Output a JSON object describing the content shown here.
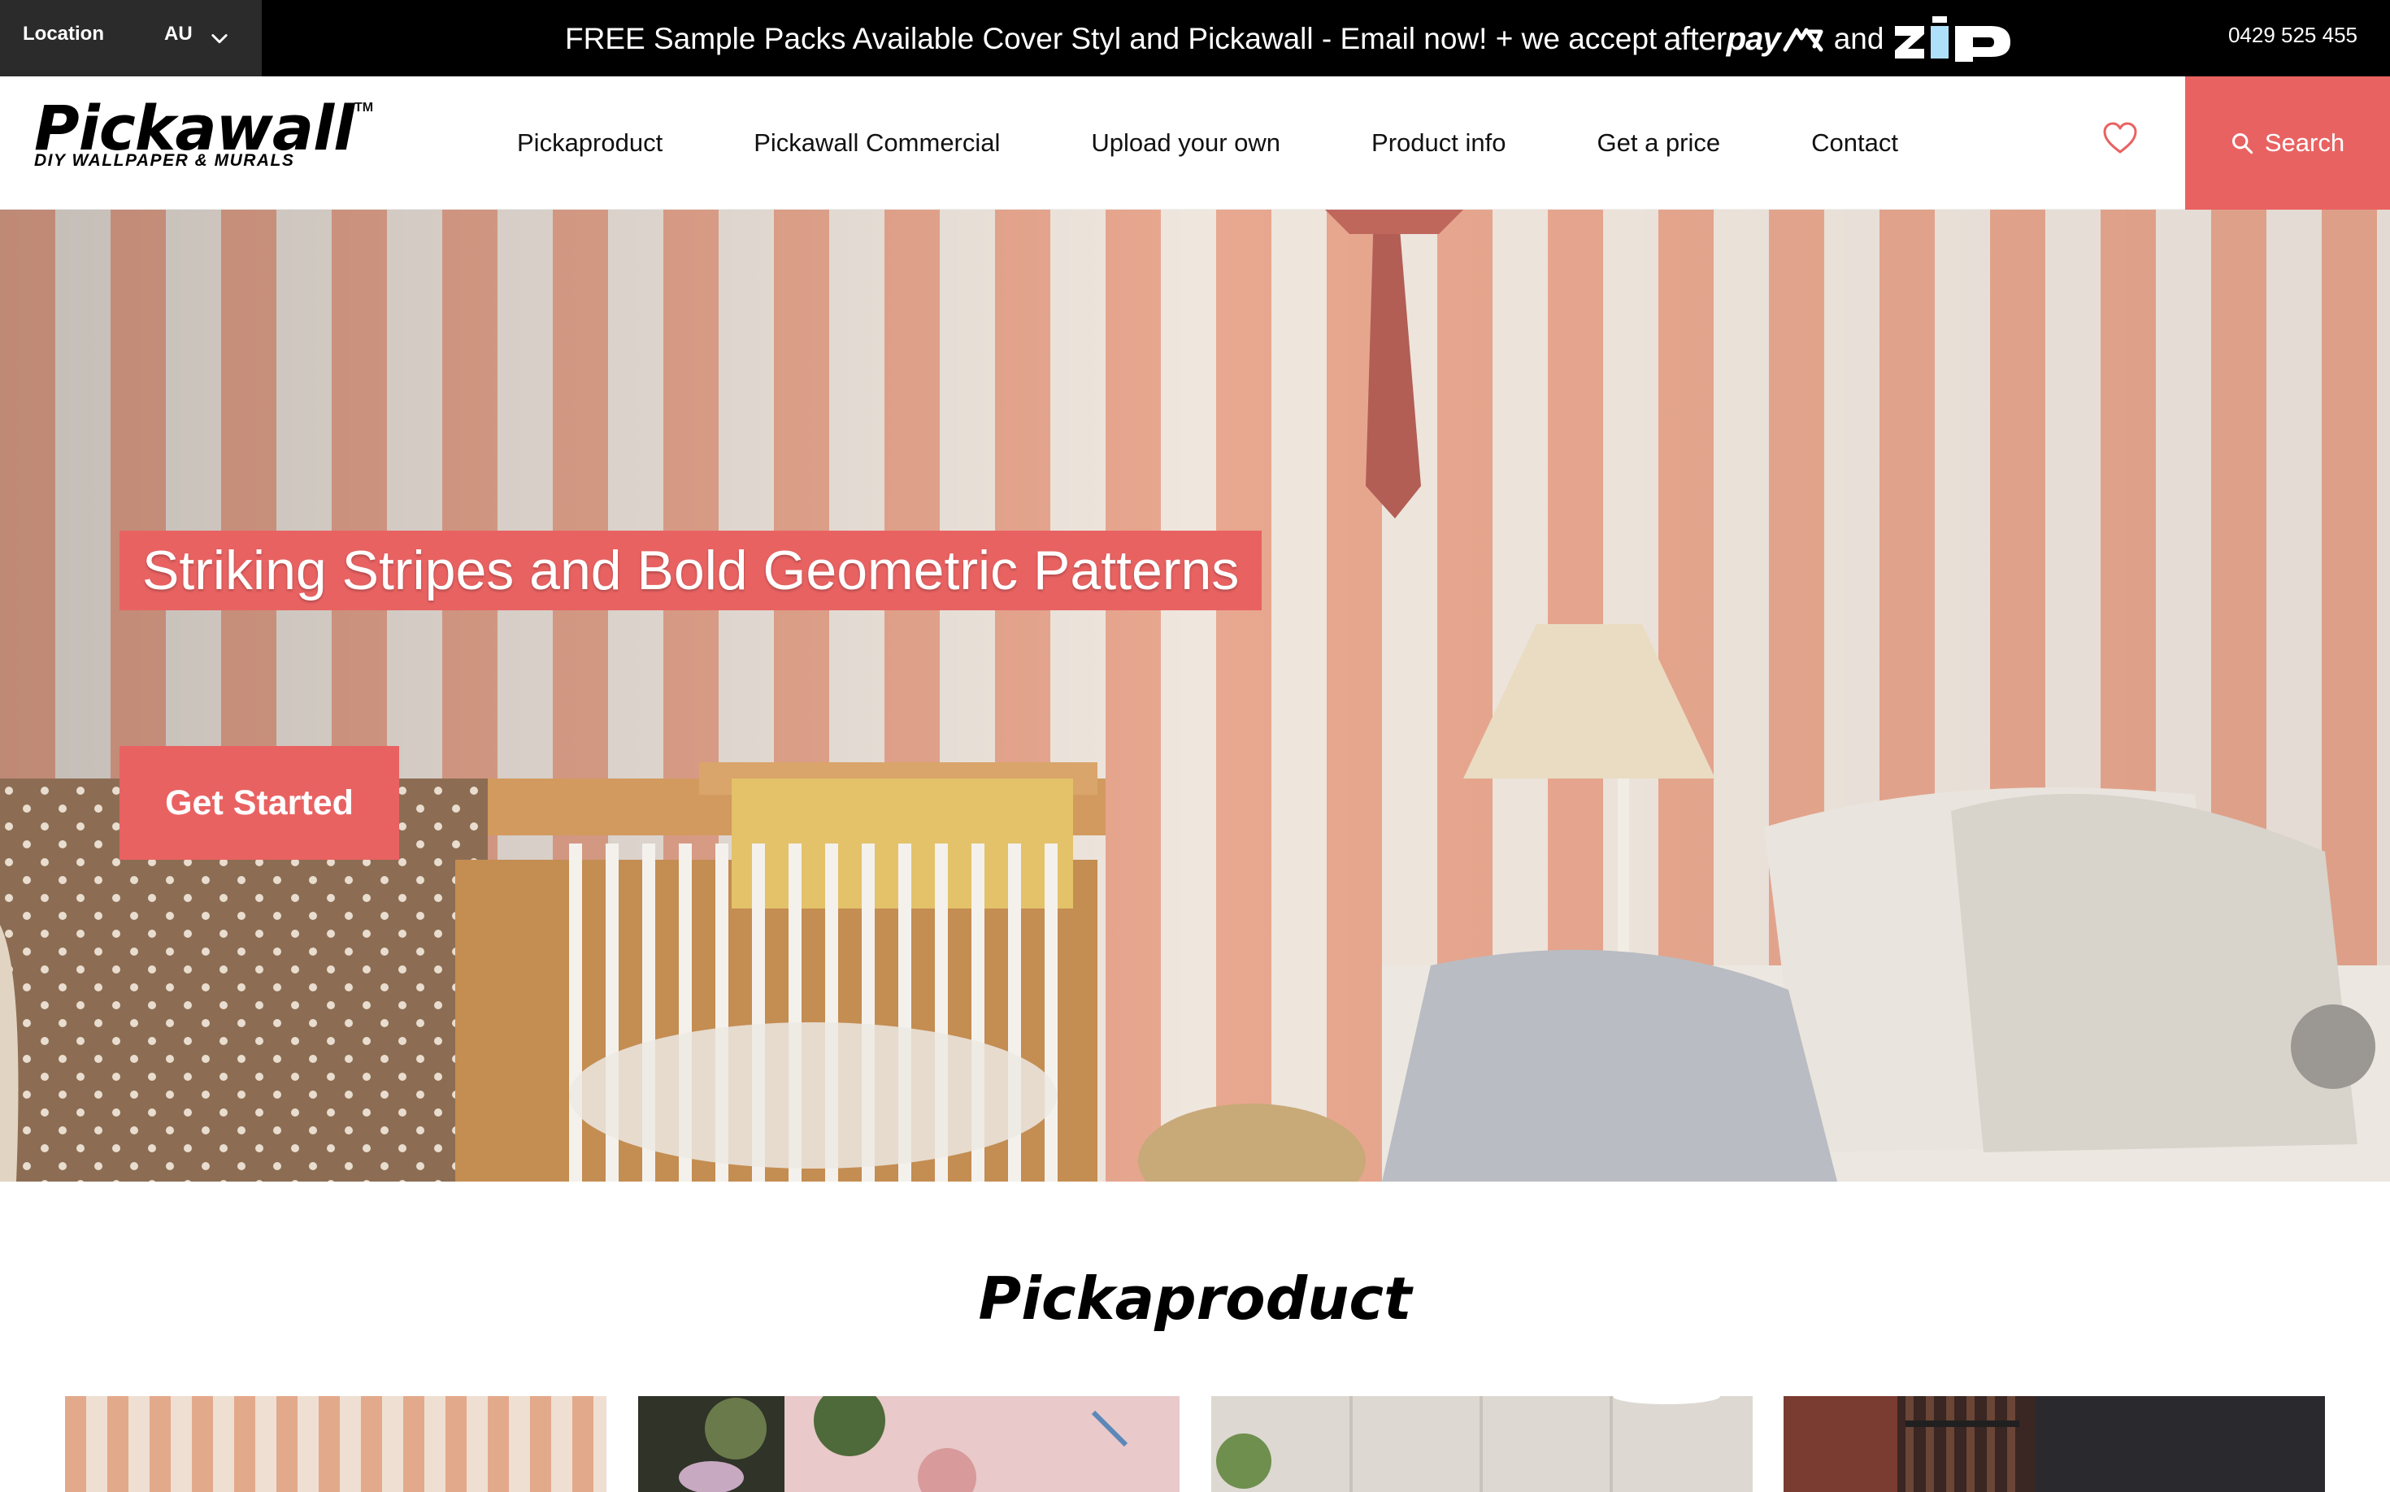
{
  "topbar": {
    "location_label": "Location",
    "location_value": "AU",
    "announcement": "FREE Sample Packs Available Cover Styl and Pickawall - Email now! + we accept",
    "afterpay_after": "after",
    "afterpay_pay": "pay",
    "and_text": "and",
    "zip_text": "ZIP",
    "phone": "0429 525 455"
  },
  "header": {
    "logo_name": "Pickawall",
    "logo_tm": "TM",
    "logo_tagline": "DIY WALLPAPER & MURALS",
    "nav": [
      {
        "label": "Pickaproduct"
      },
      {
        "label": "Pickawall Commercial"
      },
      {
        "label": "Upload your own"
      },
      {
        "label": "Product info"
      },
      {
        "label": "Get a price"
      },
      {
        "label": "Contact"
      }
    ],
    "search_label": "Search"
  },
  "hero": {
    "heading": "Striking Stripes and Bold Geometric Patterns",
    "cta_label": "Get Started"
  },
  "section": {
    "title": "Pickaproduct"
  },
  "colors": {
    "accent": "#e96262",
    "topbar_bg": "#000000",
    "location_bg": "#2b2b2b",
    "afterpay_mint": "#b2fce4",
    "zip_blue": "#aee1f9"
  },
  "icons": [
    "chevron-down-icon",
    "afterpay-logo-icon",
    "zip-logo-icon",
    "heart-icon",
    "search-icon"
  ]
}
